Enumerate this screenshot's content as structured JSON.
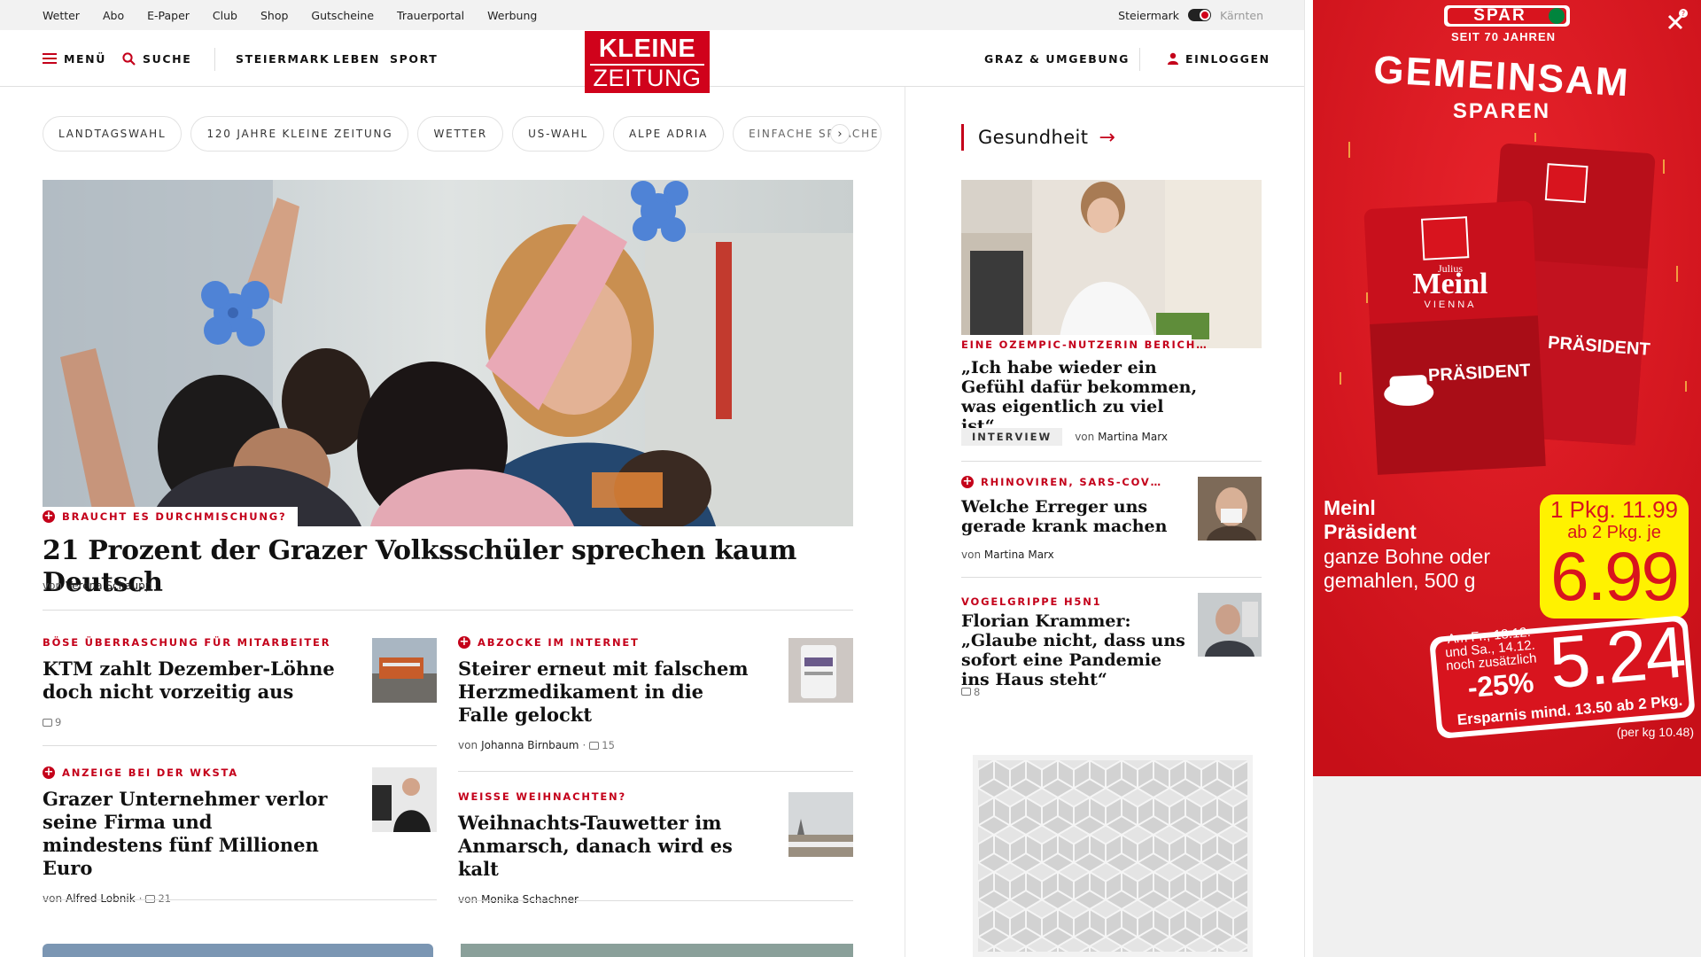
{
  "utility": {
    "links": [
      "Wetter",
      "Abo",
      "E-Paper",
      "Club",
      "Shop",
      "Gutscheine",
      "Trauerportal",
      "Werbung"
    ],
    "region_active": "Steiermark",
    "region_inactive": "Kärnten"
  },
  "nav": {
    "menu": "MENÜ",
    "search": "SUCHE",
    "sections": [
      "STEIERMARK",
      "LEBEN",
      "SPORT"
    ],
    "local": "GRAZ & UMGEBUNG",
    "login": "EINLOGGEN",
    "logo_line1": "KLEINE",
    "logo_line2": "ZEITUNG"
  },
  "chips": [
    "LANDTAGSWAHL",
    "120 JAHRE KLEINE ZEITUNG",
    "WETTER",
    "US-WAHL",
    "ALPE ADRIA",
    "EINFACHE SPRACHE"
  ],
  "hero": {
    "kicker": "BRAUCHT ES DURCHMISCHUNG?",
    "title": "21 Prozent der Grazer Volksschüler sprechen kaum Deutsch",
    "by": "von",
    "author": "Verena Schaupp"
  },
  "articles": [
    {
      "kicker": "BÖSE ÜBERRASCHUNG FÜR MITARBEITER",
      "title": "KTM zahlt Dezember-Löhne doch nicht vorzeitig aus",
      "comments": "9"
    },
    {
      "kicker": "ABZOCKE IM INTERNET",
      "title": "Steirer erneut mit falschem Herzmedikament in die Falle gelockt",
      "by": "von",
      "author": "Johanna Birnbaum",
      "comments": "15"
    },
    {
      "kicker": "ANZEIGE BEI DER WKSTA",
      "title": "Grazer Unternehmer verlor seine Firma und mindestens fünf Millionen Euro",
      "by": "von",
      "author": "Alfred Lobnik",
      "comments": "21"
    },
    {
      "kicker": "WEISSE WEIHNACHTEN?",
      "title": "Weihnachts-Tauwetter im Anmarsch, danach wird es kalt",
      "by": "von",
      "author": "Monika Schachner"
    }
  ],
  "sidebar": {
    "heading": "Gesundheit",
    "main": {
      "kicker": "EINE OZEMPIC-NUTZERIN BERICH…",
      "title": "„Ich habe wieder ein Gefühl dafür bekommen, was eigentlich zu viel ist“",
      "tag": "INTERVIEW",
      "by": "von",
      "author": "Martina Marx"
    },
    "items": [
      {
        "kicker": "RHINOVIREN, SARS-COV…",
        "title": "Welche Erreger uns gerade krank machen",
        "by": "von",
        "author": "Martina Marx"
      },
      {
        "kicker": "VOGELGRIPPE H5N1",
        "title": "Florian Krammer: „Glaube nicht, dass uns sofort eine Pandemie ins Haus steht“",
        "comments": "8"
      }
    ]
  },
  "ad": {
    "brand": "SPAR",
    "since": "SEIT 70 JAHREN",
    "headline1": "GEMEINSAM",
    "headline2": "SPAREN",
    "pack_brand_small": "Julius",
    "pack_brand": "Meinl",
    "pack_city": "VIENNA",
    "pack_product": "PRÄSIDENT",
    "product_name1": "Meinl",
    "product_name2": "Präsident",
    "product_desc": "ganze Bohne oder gemahlen, 500 g",
    "price_line1": "1 Pkg. 11.99",
    "price_line2": "ab 2 Pkg. je",
    "price_big": "6.99",
    "promo_dates": "Am Fr., 13.12. und Sa., 14.12. noch zusätzlich",
    "promo_percent": "-25%",
    "promo_price": "5.24",
    "savings": "Ersparnis mind. 13.50 ab 2 Pkg.",
    "per_kg": "(per kg 10.48)"
  }
}
